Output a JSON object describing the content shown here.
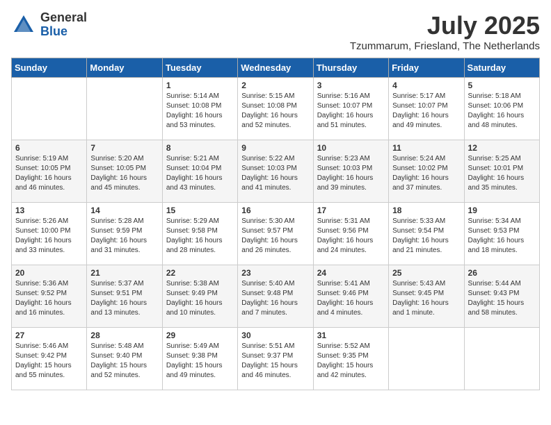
{
  "header": {
    "logo_general": "General",
    "logo_blue": "Blue",
    "month_year": "July 2025",
    "location": "Tzummarum, Friesland, The Netherlands"
  },
  "days_of_week": [
    "Sunday",
    "Monday",
    "Tuesday",
    "Wednesday",
    "Thursday",
    "Friday",
    "Saturday"
  ],
  "weeks": [
    [
      {
        "day": "",
        "detail": ""
      },
      {
        "day": "",
        "detail": ""
      },
      {
        "day": "1",
        "detail": "Sunrise: 5:14 AM\nSunset: 10:08 PM\nDaylight: 16 hours\nand 53 minutes."
      },
      {
        "day": "2",
        "detail": "Sunrise: 5:15 AM\nSunset: 10:08 PM\nDaylight: 16 hours\nand 52 minutes."
      },
      {
        "day": "3",
        "detail": "Sunrise: 5:16 AM\nSunset: 10:07 PM\nDaylight: 16 hours\nand 51 minutes."
      },
      {
        "day": "4",
        "detail": "Sunrise: 5:17 AM\nSunset: 10:07 PM\nDaylight: 16 hours\nand 49 minutes."
      },
      {
        "day": "5",
        "detail": "Sunrise: 5:18 AM\nSunset: 10:06 PM\nDaylight: 16 hours\nand 48 minutes."
      }
    ],
    [
      {
        "day": "6",
        "detail": "Sunrise: 5:19 AM\nSunset: 10:05 PM\nDaylight: 16 hours\nand 46 minutes."
      },
      {
        "day": "7",
        "detail": "Sunrise: 5:20 AM\nSunset: 10:05 PM\nDaylight: 16 hours\nand 45 minutes."
      },
      {
        "day": "8",
        "detail": "Sunrise: 5:21 AM\nSunset: 10:04 PM\nDaylight: 16 hours\nand 43 minutes."
      },
      {
        "day": "9",
        "detail": "Sunrise: 5:22 AM\nSunset: 10:03 PM\nDaylight: 16 hours\nand 41 minutes."
      },
      {
        "day": "10",
        "detail": "Sunrise: 5:23 AM\nSunset: 10:03 PM\nDaylight: 16 hours\nand 39 minutes."
      },
      {
        "day": "11",
        "detail": "Sunrise: 5:24 AM\nSunset: 10:02 PM\nDaylight: 16 hours\nand 37 minutes."
      },
      {
        "day": "12",
        "detail": "Sunrise: 5:25 AM\nSunset: 10:01 PM\nDaylight: 16 hours\nand 35 minutes."
      }
    ],
    [
      {
        "day": "13",
        "detail": "Sunrise: 5:26 AM\nSunset: 10:00 PM\nDaylight: 16 hours\nand 33 minutes."
      },
      {
        "day": "14",
        "detail": "Sunrise: 5:28 AM\nSunset: 9:59 PM\nDaylight: 16 hours\nand 31 minutes."
      },
      {
        "day": "15",
        "detail": "Sunrise: 5:29 AM\nSunset: 9:58 PM\nDaylight: 16 hours\nand 28 minutes."
      },
      {
        "day": "16",
        "detail": "Sunrise: 5:30 AM\nSunset: 9:57 PM\nDaylight: 16 hours\nand 26 minutes."
      },
      {
        "day": "17",
        "detail": "Sunrise: 5:31 AM\nSunset: 9:56 PM\nDaylight: 16 hours\nand 24 minutes."
      },
      {
        "day": "18",
        "detail": "Sunrise: 5:33 AM\nSunset: 9:54 PM\nDaylight: 16 hours\nand 21 minutes."
      },
      {
        "day": "19",
        "detail": "Sunrise: 5:34 AM\nSunset: 9:53 PM\nDaylight: 16 hours\nand 18 minutes."
      }
    ],
    [
      {
        "day": "20",
        "detail": "Sunrise: 5:36 AM\nSunset: 9:52 PM\nDaylight: 16 hours\nand 16 minutes."
      },
      {
        "day": "21",
        "detail": "Sunrise: 5:37 AM\nSunset: 9:51 PM\nDaylight: 16 hours\nand 13 minutes."
      },
      {
        "day": "22",
        "detail": "Sunrise: 5:38 AM\nSunset: 9:49 PM\nDaylight: 16 hours\nand 10 minutes."
      },
      {
        "day": "23",
        "detail": "Sunrise: 5:40 AM\nSunset: 9:48 PM\nDaylight: 16 hours\nand 7 minutes."
      },
      {
        "day": "24",
        "detail": "Sunrise: 5:41 AM\nSunset: 9:46 PM\nDaylight: 16 hours\nand 4 minutes."
      },
      {
        "day": "25",
        "detail": "Sunrise: 5:43 AM\nSunset: 9:45 PM\nDaylight: 16 hours\nand 1 minute."
      },
      {
        "day": "26",
        "detail": "Sunrise: 5:44 AM\nSunset: 9:43 PM\nDaylight: 15 hours\nand 58 minutes."
      }
    ],
    [
      {
        "day": "27",
        "detail": "Sunrise: 5:46 AM\nSunset: 9:42 PM\nDaylight: 15 hours\nand 55 minutes."
      },
      {
        "day": "28",
        "detail": "Sunrise: 5:48 AM\nSunset: 9:40 PM\nDaylight: 15 hours\nand 52 minutes."
      },
      {
        "day": "29",
        "detail": "Sunrise: 5:49 AM\nSunset: 9:38 PM\nDaylight: 15 hours\nand 49 minutes."
      },
      {
        "day": "30",
        "detail": "Sunrise: 5:51 AM\nSunset: 9:37 PM\nDaylight: 15 hours\nand 46 minutes."
      },
      {
        "day": "31",
        "detail": "Sunrise: 5:52 AM\nSunset: 9:35 PM\nDaylight: 15 hours\nand 42 minutes."
      },
      {
        "day": "",
        "detail": ""
      },
      {
        "day": "",
        "detail": ""
      }
    ]
  ]
}
